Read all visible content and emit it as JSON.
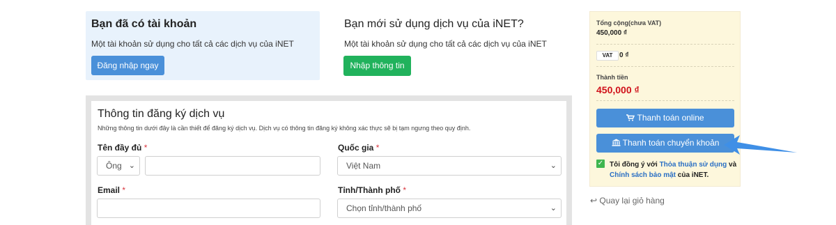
{
  "login_panel": {
    "title": "Bạn đã có tài khoản",
    "desc": "Một tài khoản sử dụng cho tất cả các dịch vụ của iNET",
    "button": "Đăng nhập ngay"
  },
  "new_panel": {
    "title": "Bạn mới sử dụng dịch vụ của iNET?",
    "desc": "Một tài khoản sử dụng cho tất cả các dịch vụ của iNET",
    "button": "Nhập thông tin"
  },
  "form": {
    "title": "Thông tin đăng ký dịch vụ",
    "desc": "Những thông tin dưới đây là cần thiết để đăng ký dịch vụ. Dịch vụ có thông tin đăng ký không xác thực sẽ bị tạm ngưng theo quy định.",
    "required_mark": "*",
    "fullname_label": "Tên đầy đủ",
    "title_select": "Ông",
    "fullname_value": "",
    "country_label": "Quốc gia",
    "country_select": "Việt Nam",
    "email_label": "Email",
    "email_value": "",
    "province_label": "Tỉnh/Thành phố",
    "province_select": "Chọn tỉnh/thành phố",
    "chevron": "⌄"
  },
  "cart": {
    "subtotal_label": "Tổng cộng(chưa VAT)",
    "subtotal_value": "450,000 ₫",
    "vat_label": "VAT",
    "vat_value": "0 ₫",
    "total_label": "Thành tiền",
    "total_value": "450,000 ₫",
    "pay_online": "Thanh toán online",
    "pay_transfer": "Thanh toán chuyển khoản",
    "agree_check": "✓",
    "agree_prefix": "Tôi đồng ý với ",
    "agree_link1": "Thỏa thuận sử dụng",
    "agree_mid": " và ",
    "agree_link2": "Chính sách bảo mật",
    "agree_suffix": " của iNET."
  },
  "back_link": "↩ Quay lại giỏ hàng",
  "colors": {
    "primary_blue": "#4a90d9",
    "green": "#21b25c",
    "price_red": "#d0121b",
    "cart_bg": "#fdf7dc",
    "arrow": "#3f8fe6"
  },
  "icons": {
    "cart": "shopping-cart-icon",
    "bank": "bank-icon",
    "back": "return-icon",
    "check": "checkbox-checked-icon"
  }
}
